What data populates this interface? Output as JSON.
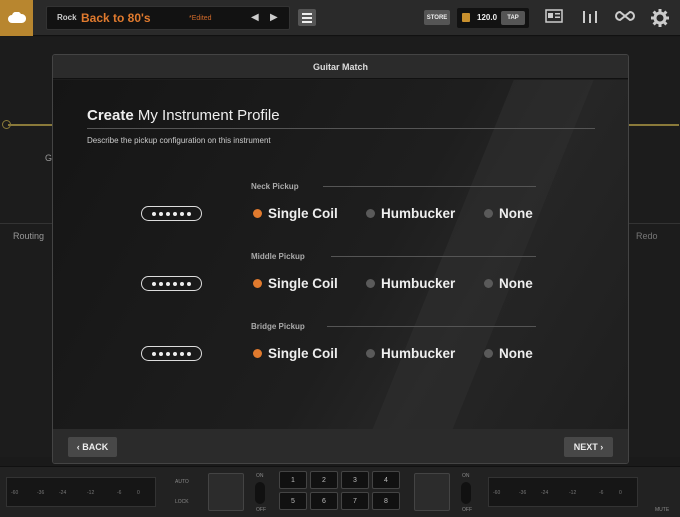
{
  "topbar": {
    "preset_category": "Rock",
    "preset_name": "Back to 80's",
    "preset_status": "*Edited",
    "prev_arrow": "◀",
    "next_arrow": "▶",
    "store_label": "STORE",
    "tempo": "120.0",
    "tap_label": "TAP"
  },
  "background": {
    "routing_label": "Routing",
    "redo_label": "Redo",
    "partial_label": "G"
  },
  "dialog": {
    "header_title": "Guitar Match",
    "title_bold": "Create",
    "title_rest": " My Instrument Profile",
    "subtitle": "Describe the pickup configuration on this instrument",
    "sections": [
      {
        "label": "Neck Pickup",
        "selected": "Single Coil"
      },
      {
        "label": "Middle Pickup",
        "selected": "Single Coil"
      },
      {
        "label": "Bridge Pickup",
        "selected": "Single Coil"
      }
    ],
    "options": [
      "Single Coil",
      "Humbucker",
      "None"
    ],
    "back_label": "BACK",
    "next_label": "NEXT"
  },
  "bottombar": {
    "meter_ticks": [
      "-60",
      "-36",
      "-24",
      "-12",
      "-6",
      "0"
    ],
    "auto_label": "AUTO",
    "lock_label": "LOCK",
    "on_label": "ON",
    "off_label": "OFF",
    "numbers": [
      "1",
      "2",
      "3",
      "4",
      "5",
      "6",
      "7",
      "8"
    ],
    "mute_label": "MUTE"
  },
  "colors": {
    "accent": "#e07a2e",
    "store_bg": "#555555",
    "logo_bg": "#b8862f"
  }
}
